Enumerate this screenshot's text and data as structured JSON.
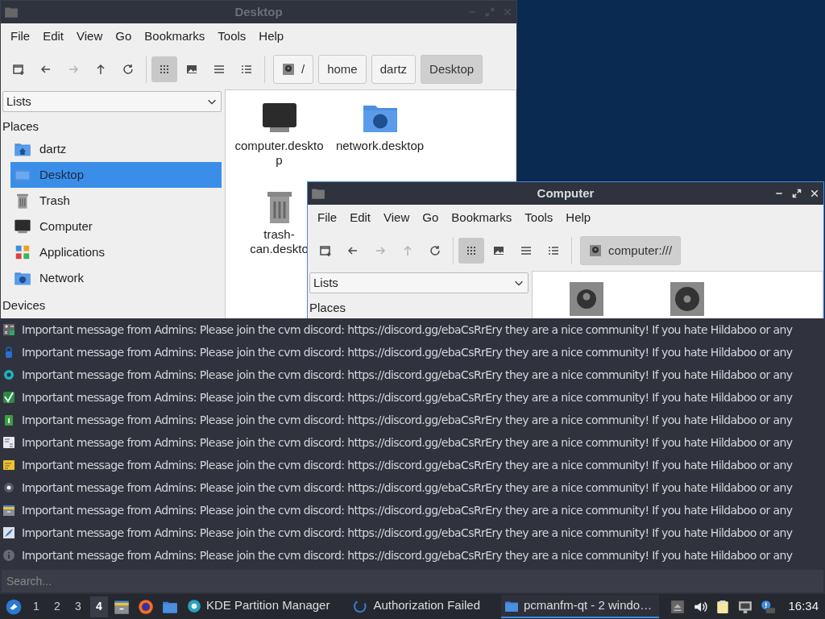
{
  "windows": [
    {
      "title": "Desktop",
      "active": false,
      "menu": [
        "File",
        "Edit",
        "View",
        "Go",
        "Bookmarks",
        "Tools",
        "Help"
      ],
      "toolbar": [
        {
          "kind": "new-window",
          "selected": false,
          "disabled": false
        },
        {
          "kind": "back",
          "selected": false,
          "disabled": false
        },
        {
          "kind": "forward",
          "selected": false,
          "disabled": true
        },
        {
          "kind": "up",
          "selected": false,
          "disabled": false
        },
        {
          "kind": "reload",
          "selected": false,
          "disabled": false
        },
        {
          "kind": "icons",
          "selected": true,
          "disabled": false
        },
        {
          "kind": "thumbnails",
          "selected": false,
          "disabled": false
        },
        {
          "kind": "compact",
          "selected": false,
          "disabled": false
        },
        {
          "kind": "detailed",
          "selected": false,
          "disabled": false
        }
      ],
      "path": [
        {
          "label": "/",
          "kind": "root",
          "selected": false
        },
        {
          "label": "home",
          "kind": "dir",
          "selected": false
        },
        {
          "label": "dartz",
          "kind": "dir",
          "selected": false
        },
        {
          "label": "Desktop",
          "kind": "dir",
          "selected": true
        }
      ],
      "sidebar": {
        "dropdown": "Lists",
        "sections": [
          {
            "heading": "Places",
            "items": [
              {
                "label": "dartz",
                "kind": "home",
                "selected": false
              },
              {
                "label": "Desktop",
                "kind": "desktop",
                "selected": true
              },
              {
                "label": "Trash",
                "kind": "trash",
                "selected": false
              },
              {
                "label": "Computer",
                "kind": "computer",
                "selected": false
              },
              {
                "label": "Applications",
                "kind": "apps",
                "selected": false
              },
              {
                "label": "Network",
                "kind": "network",
                "selected": false
              }
            ]
          },
          {
            "heading": "Devices"
          }
        ]
      },
      "files": [
        {
          "label": "computer.desktop",
          "kind": "computer"
        },
        {
          "label": "network.desktop",
          "kind": "network"
        },
        {
          "label": "trash-can.deskto",
          "kind": "trash"
        }
      ]
    },
    {
      "title": "Computer",
      "active": true,
      "menu": [
        "File",
        "Edit",
        "View",
        "Go",
        "Bookmarks",
        "Tools",
        "Help"
      ],
      "toolbar": [
        {
          "kind": "new-window",
          "selected": false,
          "disabled": false
        },
        {
          "kind": "back",
          "selected": false,
          "disabled": false
        },
        {
          "kind": "forward",
          "selected": false,
          "disabled": true
        },
        {
          "kind": "up",
          "selected": false,
          "disabled": true
        },
        {
          "kind": "reload",
          "selected": false,
          "disabled": false
        },
        {
          "kind": "icons",
          "selected": true,
          "disabled": false
        },
        {
          "kind": "thumbnails",
          "selected": false,
          "disabled": false
        },
        {
          "kind": "compact",
          "selected": false,
          "disabled": false
        },
        {
          "kind": "detailed",
          "selected": false,
          "disabled": false
        }
      ],
      "path": [
        {
          "label": "computer:///",
          "kind": "root",
          "selected": true
        }
      ],
      "sidebar": {
        "dropdown": "Lists",
        "sections": [
          {
            "heading": "Places"
          }
        ]
      },
      "files": [
        {
          "kind": "drive"
        },
        {
          "kind": "disc"
        }
      ]
    }
  ],
  "messages": [
    {
      "kind": "calculator",
      "text": "Important message from Admins: Please join the cvm discord: https://discord.gg/ebaCsRrEry they are a nice community! If you hate Hildaboo or any"
    },
    {
      "kind": "lock",
      "text": "Important message from Admins: Please join the cvm discord: https://discord.gg/ebaCsRrEry they are a nice community! If you hate Hildaboo or any"
    },
    {
      "kind": "gear",
      "text": "Important message from Admins: Please join the cvm discord: https://discord.gg/ebaCsRrEry they are a nice community! If you hate Hildaboo or any"
    },
    {
      "kind": "check",
      "text": "Important message from Admins: Please join the cvm discord: https://discord.gg/ebaCsRrEry they are a nice community! If you hate Hildaboo or any"
    },
    {
      "kind": "battery",
      "text": "Important message from Admins: Please join the cvm discord: https://discord.gg/ebaCsRrEry they are a nice community! If you hate Hildaboo or any"
    },
    {
      "kind": "document",
      "text": "Important message from Admins: Please join the cvm discord: https://discord.gg/ebaCsRrEry they are a nice community! If you hate Hildaboo or any"
    },
    {
      "kind": "note",
      "text": "Important message from Admins: Please join the cvm discord: https://discord.gg/ebaCsRrEry they are a nice community! If you hate Hildaboo or any"
    },
    {
      "kind": "cog",
      "text": "Important message from Admins: Please join the cvm discord: https://discord.gg/ebaCsRrEry they are a nice community! If you hate Hildaboo or any"
    },
    {
      "kind": "drawer",
      "text": "Important message from Admins: Please join the cvm discord: https://discord.gg/ebaCsRrEry they are a nice community! If you hate Hildaboo or any"
    },
    {
      "kind": "feather",
      "text": "Important message from Admins: Please join the cvm discord: https://discord.gg/ebaCsRrEry they are a nice community! If you hate Hildaboo or any"
    },
    {
      "kind": "info",
      "text": "Important message from Admins: Please join the cvm discord: https://discord.gg/ebaCsRrEry they are a nice community! If you hate Hildaboo or any"
    }
  ],
  "search": {
    "placeholder": "Search..."
  },
  "taskbar": {
    "workspaces": [
      {
        "label": "1",
        "selected": false
      },
      {
        "label": "2",
        "selected": false
      },
      {
        "label": "3",
        "selected": false
      },
      {
        "label": "4",
        "selected": true
      }
    ],
    "launchers": [
      {
        "kind": "drawer"
      },
      {
        "kind": "browser"
      },
      {
        "kind": "folder"
      }
    ],
    "tasks": [
      {
        "label": "KDE Partition Manager",
        "kind": "partition",
        "selected": false
      },
      {
        "label": "Authorization Failed",
        "kind": "swirl",
        "selected": false
      },
      {
        "label": "pcmanfm-qt - 2 windo…",
        "kind": "folder",
        "selected": true
      }
    ],
    "tray": [
      {
        "kind": "eject"
      },
      {
        "kind": "speaker"
      },
      {
        "kind": "clipboard"
      },
      {
        "kind": "network"
      },
      {
        "kind": "alert"
      }
    ],
    "clock": "16:34"
  }
}
